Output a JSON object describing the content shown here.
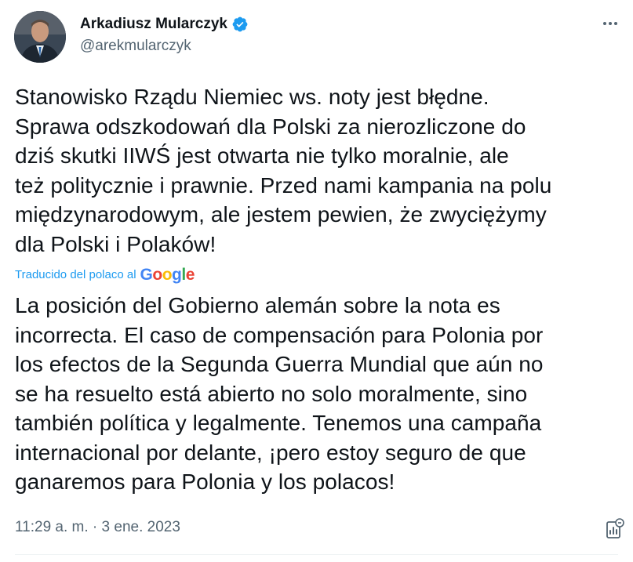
{
  "author": {
    "name": "Arkadiusz Mularczyk",
    "handle": "@arekmularczyk",
    "verified": true,
    "avatar_icon": "profile-photo"
  },
  "tweet": {
    "original_text": "Stanowisko Rządu Niemiec ws. noty jest błędne.\nSprawa odszkodowań dla Polski za nierozliczone do\ndziś  skutki IIWŚ jest otwarta nie tylko  moralnie, ale\nteż politycznie i prawnie. Przed nami kampania na polu\nmiędzynarodowym, ale jestem pewien, że zwyciężymy\ndla Polski i Polaków!",
    "translation_note": "Traducido del polaco al",
    "translation_provider": "Google",
    "translated_text": "La posición del Gobierno alemán sobre la nota es\nincorrecta. El caso de compensación para Polonia por\nlos efectos de la Segunda Guerra Mundial que aún no\nse ha resuelto está abierto no solo moralmente, sino\ntambién política y legalmente. Tenemos una campaña\ninternacional por delante, ¡pero estoy seguro de que\nganaremos para Polonia y los polacos!",
    "timestamp": "11:29 a. m. · 3 ene. 2023"
  },
  "icons": {
    "more": "more-horizontal-icon",
    "verified": "verified-badge-icon",
    "analytics": "tweet-analytics-icon"
  },
  "colors": {
    "text": "#0f1419",
    "secondary": "#536471",
    "accent": "#1d9bf0"
  }
}
